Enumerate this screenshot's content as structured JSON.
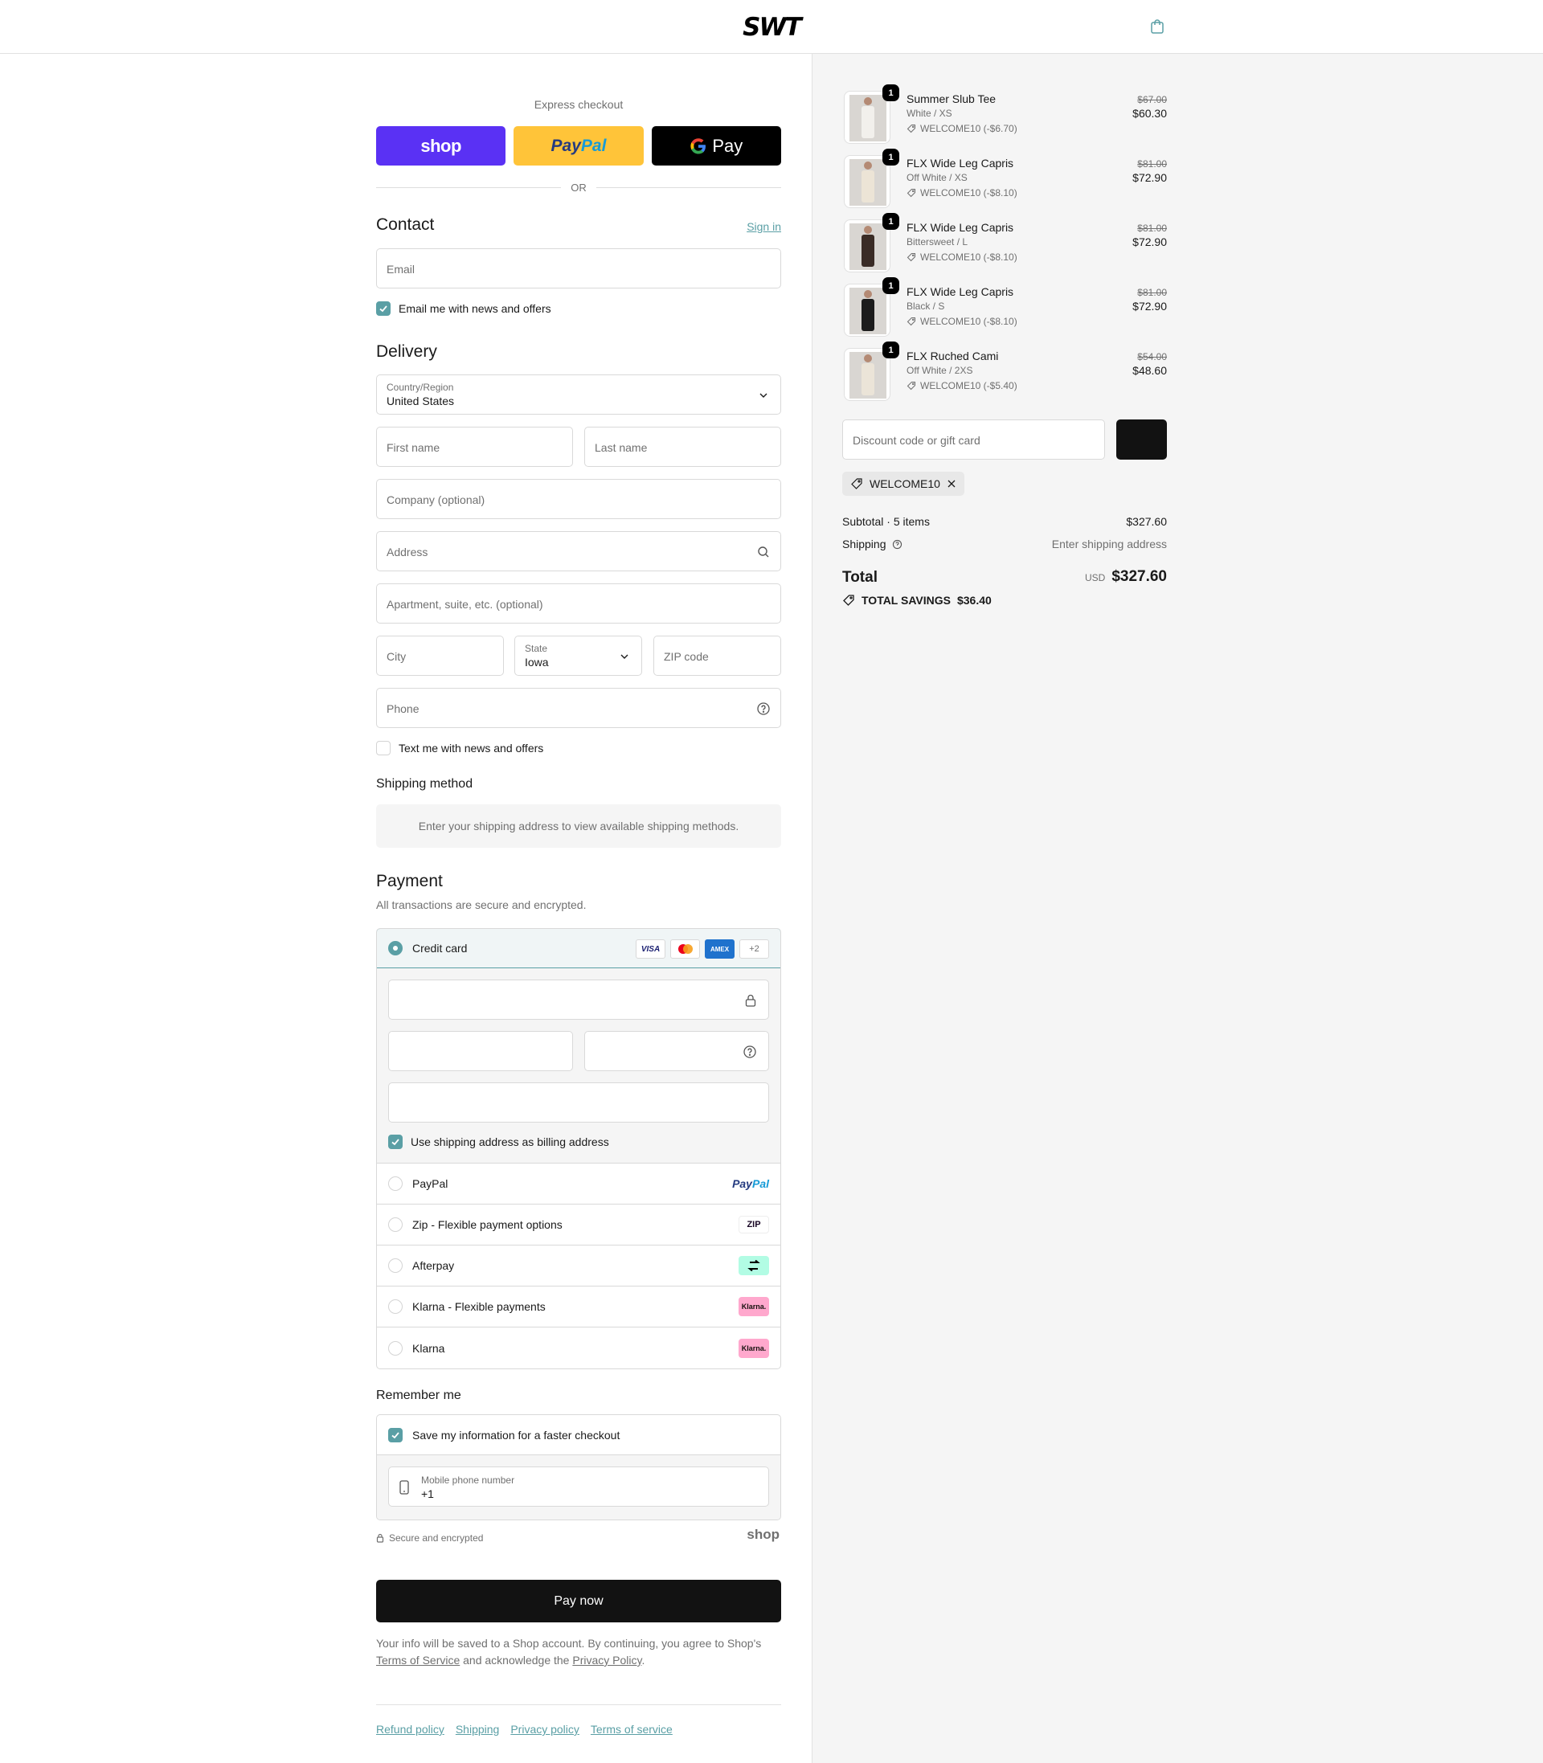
{
  "header": {
    "brand": "SWT"
  },
  "express": {
    "title": "Express checkout",
    "shop_label": "shop",
    "paypal_label_a": "Pay",
    "paypal_label_b": "Pal",
    "gpay_label": "Pay",
    "or": "OR"
  },
  "contact": {
    "title": "Contact",
    "sign_in": "Sign in",
    "email_placeholder": "Email",
    "newsletter_label": "Email me with news and offers",
    "newsletter_checked": true
  },
  "delivery": {
    "title": "Delivery",
    "country_label": "Country/Region",
    "country_value": "United States",
    "first_name_placeholder": "First name",
    "last_name_placeholder": "Last name",
    "company_placeholder": "Company (optional)",
    "address_placeholder": "Address",
    "apartment_placeholder": "Apartment, suite, etc. (optional)",
    "city_placeholder": "City",
    "state_label": "State",
    "state_value": "Iowa",
    "zip_placeholder": "ZIP code",
    "phone_placeholder": "Phone",
    "sms_label": "Text me with news and offers",
    "sms_checked": false
  },
  "shipping_method": {
    "title": "Shipping method",
    "message": "Enter your shipping address to view available shipping methods."
  },
  "payment": {
    "title": "Payment",
    "subtitle": "All transactions are secure and encrypted.",
    "credit_card_label": "Credit card",
    "card_brands": [
      "VISA",
      "mastercard",
      "AMEX"
    ],
    "more_cards": "+2",
    "billing_label": "Use shipping address as billing address",
    "billing_checked": true,
    "alternatives": [
      {
        "label": "PayPal",
        "logo": "paypal"
      },
      {
        "label": "Zip - Flexible payment options",
        "logo": "zip"
      },
      {
        "label": "Afterpay",
        "logo": "afterpay"
      },
      {
        "label": "Klarna - Flexible payments",
        "logo": "klarna"
      },
      {
        "label": "Klarna",
        "logo": "klarna"
      }
    ],
    "zip_logo_text": "ZIP",
    "klarna_logo_text": "Klarna."
  },
  "remember": {
    "title": "Remember me",
    "save_label": "Save my information for a faster checkout",
    "save_checked": true,
    "mobile_label": "Mobile phone number",
    "mobile_value": "+1"
  },
  "secure": {
    "label": "Secure and encrypted",
    "shop": "shop"
  },
  "pay_now": "Pay now",
  "legal": {
    "text_a": "Your info will be saved to a Shop account. By continuing, you agree to Shop's ",
    "terms": "Terms of Service",
    "text_b": " and acknowledge the ",
    "privacy": "Privacy Policy",
    "text_c": "."
  },
  "footer": [
    "Refund policy",
    "Shipping",
    "Privacy policy",
    "Terms of service"
  ],
  "cart": {
    "items": [
      {
        "name": "Summer Slub Tee",
        "variant": "White / XS",
        "discount": "WELCOME10 (-$6.70)",
        "original": "$67.00",
        "price": "$60.30",
        "qty": "1",
        "color": "#f2f0ec"
      },
      {
        "name": "FLX Wide Leg Capris",
        "variant": "Off White / XS",
        "discount": "WELCOME10 (-$8.10)",
        "original": "$81.00",
        "price": "$72.90",
        "qty": "1",
        "color": "#ece4d6"
      },
      {
        "name": "FLX Wide Leg Capris",
        "variant": "Bittersweet / L",
        "discount": "WELCOME10 (-$8.10)",
        "original": "$81.00",
        "price": "$72.90",
        "qty": "1",
        "color": "#3a2c26"
      },
      {
        "name": "FLX Wide Leg Capris",
        "variant": "Black / S",
        "discount": "WELCOME10 (-$8.10)",
        "original": "$81.00",
        "price": "$72.90",
        "qty": "1",
        "color": "#1c1c1c"
      },
      {
        "name": "FLX Ruched Cami",
        "variant": "Off White / 2XS",
        "discount": "WELCOME10 (-$5.40)",
        "original": "$54.00",
        "price": "$48.60",
        "qty": "1",
        "color": "#ebe4d8"
      }
    ],
    "discount_placeholder": "Discount code or gift card",
    "applied_code": "WELCOME10",
    "subtotal_label": "Subtotal · 5 items",
    "subtotal_value": "$327.60",
    "shipping_label": "Shipping",
    "shipping_value": "Enter shipping address",
    "total_label": "Total",
    "total_currency": "USD",
    "total_value": "$327.60",
    "savings_label": "TOTAL SAVINGS",
    "savings_value": "$36.40"
  },
  "colors": {
    "accent": "#5a9fa5",
    "shop": "#5a31f4",
    "paypal_yellow": "#ffc439",
    "button_dark": "#121212"
  }
}
